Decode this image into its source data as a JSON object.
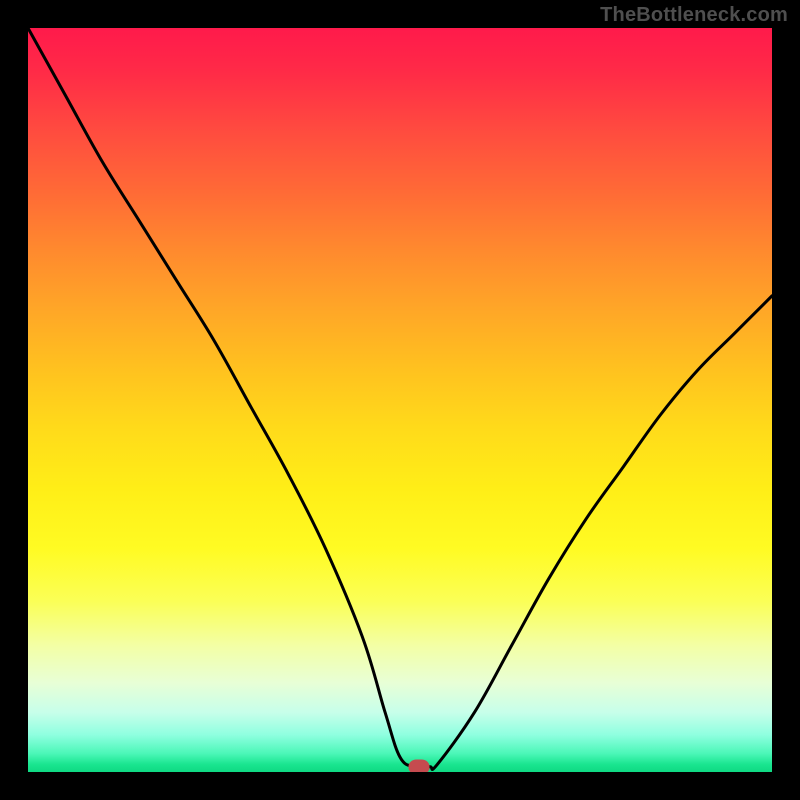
{
  "watermark": "TheBottleneck.com",
  "chart_data": {
    "type": "line",
    "title": "",
    "xlabel": "",
    "ylabel": "",
    "xlim": [
      0,
      100
    ],
    "ylim": [
      0,
      100
    ],
    "x": [
      0,
      5,
      10,
      15,
      20,
      25,
      30,
      35,
      40,
      45,
      48,
      50,
      52,
      54,
      55,
      60,
      65,
      70,
      75,
      80,
      85,
      90,
      95,
      100
    ],
    "values": [
      100,
      91,
      82,
      74,
      66,
      58,
      49,
      40,
      30,
      18,
      8,
      2,
      0.7,
      0.7,
      1,
      8,
      17,
      26,
      34,
      41,
      48,
      54,
      59,
      64
    ],
    "marker": {
      "x": 52.5,
      "y": 0.7
    },
    "gradient_stops": [
      {
        "pos": 0,
        "color": "#ff1a4b"
      },
      {
        "pos": 0.3,
        "color": "#ff8a2e"
      },
      {
        "pos": 0.55,
        "color": "#ffdb1a"
      },
      {
        "pos": 0.78,
        "color": "#faff5a"
      },
      {
        "pos": 0.9,
        "color": "#dcffe0"
      },
      {
        "pos": 1.0,
        "color": "#0fd983"
      }
    ]
  }
}
